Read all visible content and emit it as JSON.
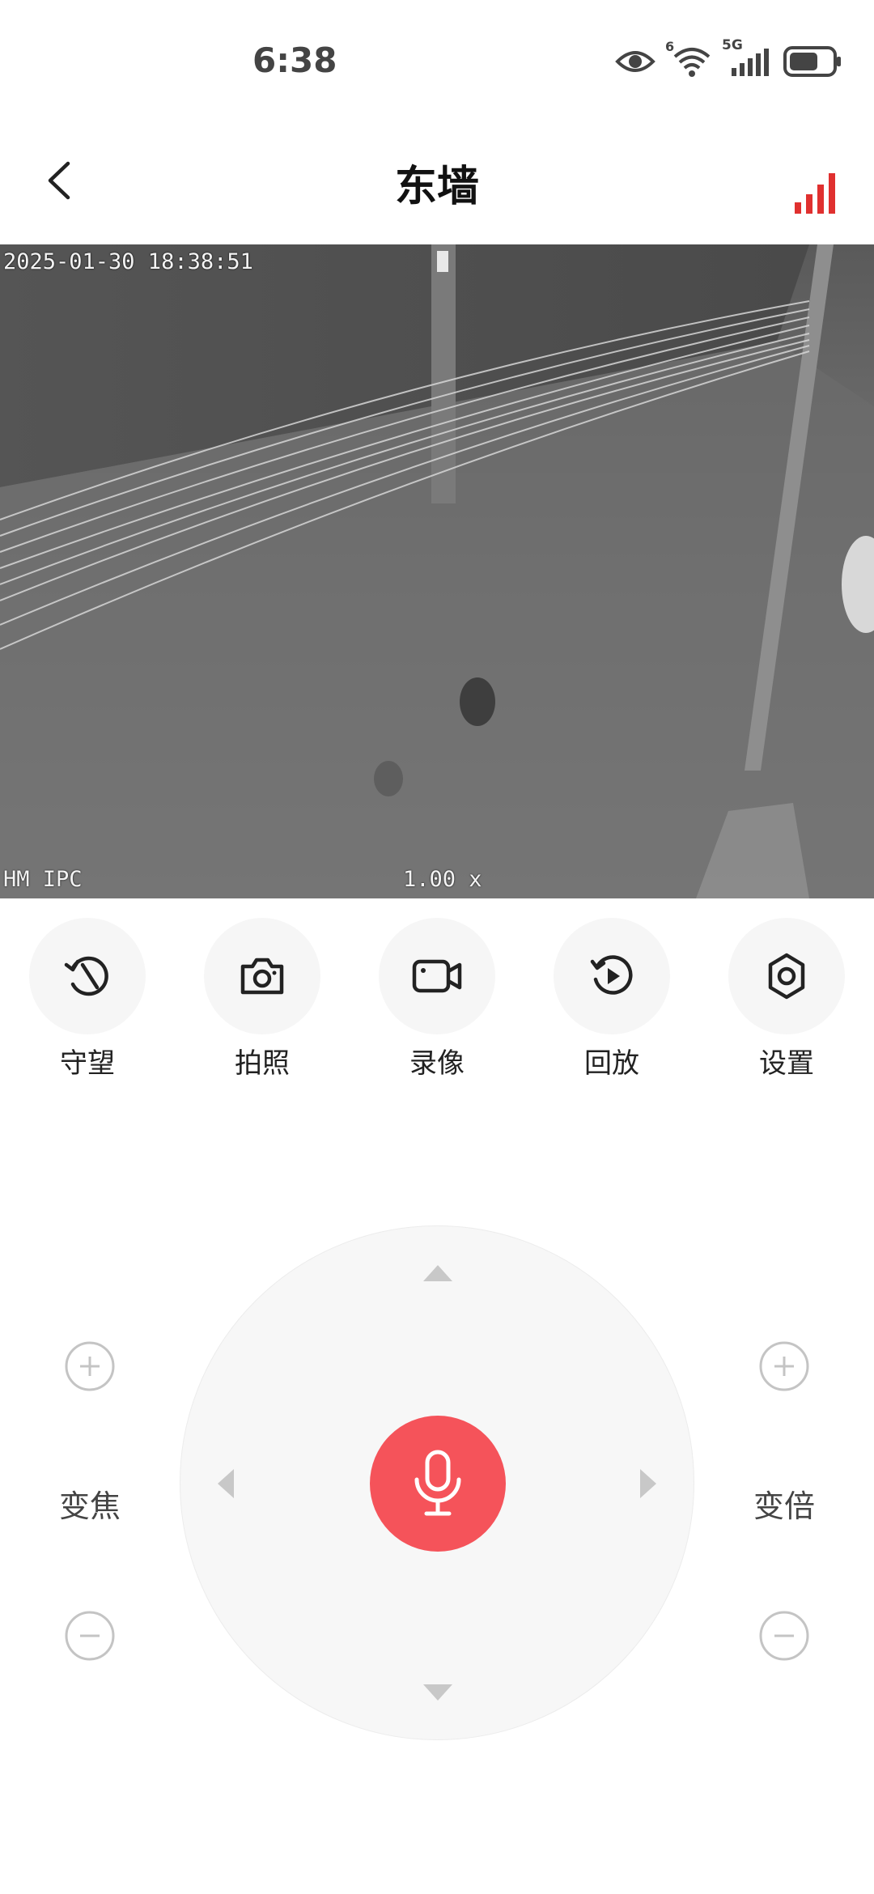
{
  "status_bar": {
    "time": "6:38",
    "icons": [
      "eye-icon",
      "wifi-icon",
      "cellular-5g-icon",
      "battery-icon"
    ],
    "wifi_badge": "6",
    "network_badge": "5G"
  },
  "header": {
    "title": "东墙",
    "back_icon": "chevron-left-icon",
    "signal_icon": "signal-strength-icon",
    "signal_color": "#e0302f"
  },
  "video": {
    "timestamp": "2025-01-30 18:38:51",
    "brand": "HM IPC",
    "zoom": "1.00 x"
  },
  "toolbar": {
    "items": [
      {
        "label": "守望",
        "icon": "watch-rotate-icon"
      },
      {
        "label": "拍照",
        "icon": "camera-icon"
      },
      {
        "label": "录像",
        "icon": "video-camera-icon"
      },
      {
        "label": "回放",
        "icon": "playback-icon"
      },
      {
        "label": "设置",
        "icon": "gear-icon"
      }
    ]
  },
  "controls": {
    "focus_label": "变焦",
    "zoom_label": "变倍",
    "mic_color": "#f5535a",
    "mic_icon": "microphone-icon"
  }
}
